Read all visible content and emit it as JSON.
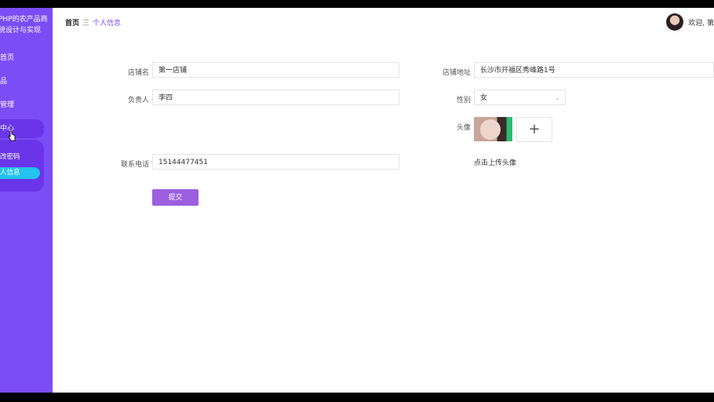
{
  "app": {
    "title_line1": "PHP的农产品商",
    "title_line2": "统设计与实现"
  },
  "sidebar": {
    "items": [
      {
        "label": "首页"
      },
      {
        "label": "品"
      },
      {
        "label": "管理"
      },
      {
        "label": "中心"
      }
    ],
    "submenu": [
      {
        "label": "改密码"
      },
      {
        "label": "人信息"
      }
    ]
  },
  "breadcrumb": {
    "home": "首页",
    "separator": "三",
    "current": "个人信息"
  },
  "user": {
    "welcome": "欢迎, 第"
  },
  "form": {
    "shop_name": {
      "label": "店铺名",
      "value": "第一店铺"
    },
    "shop_address": {
      "label": "店铺地址",
      "value": "长沙市开福区秀峰路1号"
    },
    "manager": {
      "label": "负责人",
      "value": "李四"
    },
    "gender": {
      "label": "性别",
      "value": "女"
    },
    "avatar": {
      "label": "头像",
      "upload_hint": "点击上传头像",
      "add_symbol": "+"
    },
    "phone": {
      "label": "联系电话",
      "value": "15144477451"
    },
    "submit_label": "提交"
  },
  "colors": {
    "sidebar": "#7b4df6",
    "active_submenu": "#22c3ee",
    "button": "#9b5fe0"
  }
}
